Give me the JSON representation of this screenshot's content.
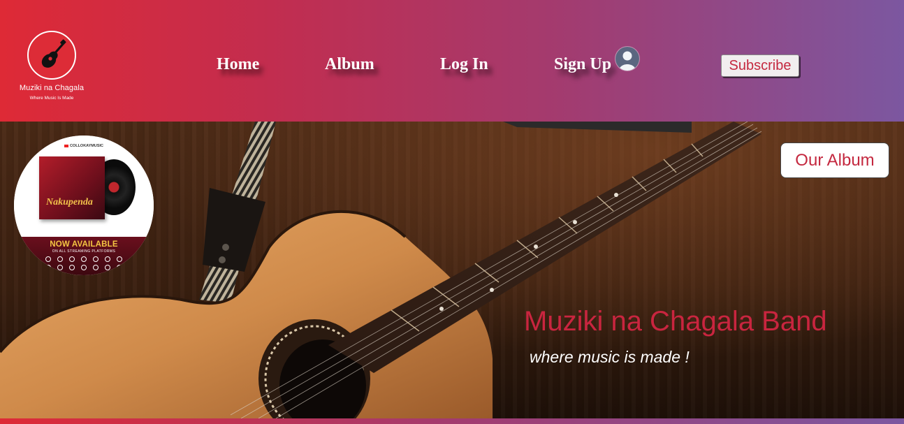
{
  "brand": {
    "name": "Muziki na Chagala",
    "tagline": "Where Music Is Made",
    "logo_icon": "guitar-icon"
  },
  "nav": {
    "items": [
      {
        "label": "Home"
      },
      {
        "label": "Album"
      },
      {
        "label": "Log In"
      },
      {
        "label": "Sign Up"
      }
    ],
    "avatar_icon": "user-avatar-icon",
    "subscribe_label": "Subscribe"
  },
  "album_promo": {
    "channel": "COLLOKAYMUSIC",
    "cover_title": "Nakupenda",
    "headline": "NOW AVAILABLE",
    "subline": "ON ALL STREAMING PLATFORMS"
  },
  "hero": {
    "our_album_label": "Our Album",
    "title": "Muziki na Chagala Band",
    "subtitle": "where music is made !"
  },
  "colors": {
    "header_gradient_start": "#de2a36",
    "header_gradient_end": "#7c57a0",
    "accent_red": "#c9253f"
  }
}
